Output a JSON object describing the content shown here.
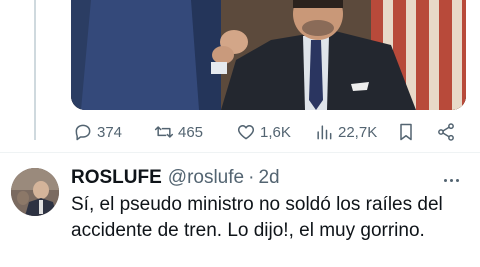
{
  "tweet": {
    "actions": {
      "replies": "374",
      "retweets": "465",
      "likes": "1,6K",
      "views": "22,7K"
    }
  },
  "reply": {
    "display_name": "ROSLUFE",
    "handle": "@roslufe",
    "separator": "·",
    "time": "2d",
    "text": "Sí, el pseudo ministro no soldó los raíles del accidente de tren. Lo dijo!, el muy gorrino."
  }
}
